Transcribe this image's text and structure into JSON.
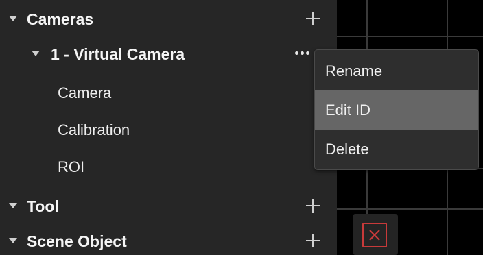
{
  "tree": {
    "sections": [
      {
        "label": "Cameras"
      },
      {
        "label": "Tool"
      },
      {
        "label": "Scene Object"
      }
    ],
    "camera_item": {
      "label": "1 - Virtual Camera"
    },
    "camera_children": [
      {
        "label": "Camera"
      },
      {
        "label": "Calibration"
      },
      {
        "label": "ROI"
      }
    ]
  },
  "context_menu": {
    "items": [
      {
        "label": "Rename"
      },
      {
        "label": "Edit ID"
      },
      {
        "label": "Delete"
      }
    ],
    "hovered_index": 1
  },
  "icons": {
    "expand": "caret-down-icon",
    "add": "plus-icon",
    "more": "ellipsis-icon",
    "close": "close-icon"
  },
  "colors": {
    "sidebar_bg": "#262626",
    "menu_bg": "#2e2e2e",
    "menu_hover": "#666666",
    "close_red": "#c83a3a"
  }
}
